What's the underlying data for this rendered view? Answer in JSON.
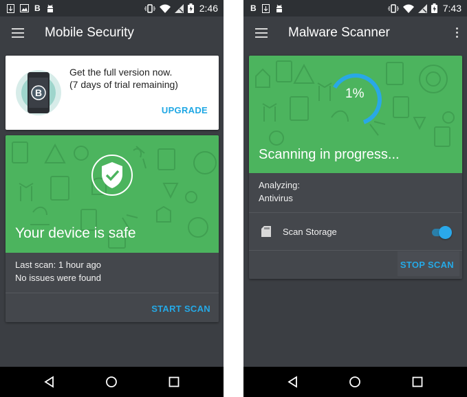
{
  "left": {
    "status": {
      "time": "2:46",
      "left_icons": [
        "download-icon",
        "image-icon",
        "b-icon",
        "android-icon"
      ],
      "right_icons": [
        "vibrate-icon",
        "wifi-icon",
        "no-sim-icon",
        "battery-charging-icon"
      ],
      "b_glyph": "B"
    },
    "appbar": {
      "title": "Mobile Security"
    },
    "upgrade_card": {
      "line1": "Get the full version now.",
      "line2": "(7 days of trial remaining)",
      "button": "UPGRADE",
      "badge_letter": "B"
    },
    "status_card": {
      "headline": "Your device is safe",
      "last_scan": "Last scan: 1 hour ago",
      "issues": "No issues were found",
      "button": "START SCAN"
    }
  },
  "right": {
    "status": {
      "time": "7:43",
      "left_icons": [
        "b-icon",
        "download-icon",
        "android-icon"
      ],
      "right_icons": [
        "vibrate-icon",
        "wifi-icon",
        "no-sim-icon",
        "battery-charging-icon"
      ],
      "b_glyph": "B"
    },
    "appbar": {
      "title": "Malware Scanner"
    },
    "scan_card": {
      "progress_percent": 1,
      "progress_label": "1%",
      "headline": "Scanning in progress...",
      "analyzing_label": "Analyzing:",
      "analyzing_value": "Antivirus",
      "storage_label": "Scan Storage",
      "storage_enabled": true,
      "button": "STOP SCAN"
    }
  },
  "colors": {
    "accent": "#25a9e6",
    "green": "#4cb45e",
    "background": "#3b3e43",
    "card_body": "#44474c"
  }
}
